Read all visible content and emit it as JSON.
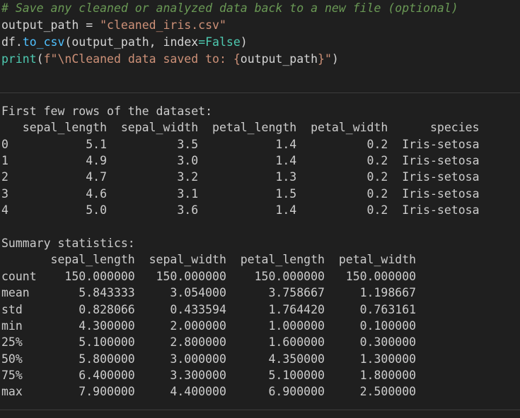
{
  "code": {
    "line1": {
      "comment": "# Save any cleaned or analyzed data back to a new file (optional)"
    },
    "line2": {
      "var": "output_path",
      "op": " = ",
      "str": "\"cleaned_iris.csv\""
    },
    "line3": {
      "obj": "df",
      "dot": ".",
      "method": "to_csv",
      "open": "(",
      "arg1": "output_path",
      "sep": ", ",
      "kwarg": "index",
      "eq": "=",
      "val": "False",
      "close": ")"
    },
    "line4": {
      "func": "print",
      "open": "(",
      "prefix": "f",
      "str_start": "\"\\nCleaned data saved to: ",
      "brace_open": "{",
      "inner": "output_path",
      "brace_close": "}",
      "str_end": "\"",
      "close": ")"
    }
  },
  "output": {
    "heading1": "First few rows of the dataset:",
    "head_table": {
      "header": "   sepal_length  sepal_width  petal_length  petal_width      species",
      "rows": [
        "0           5.1          3.5           1.4          0.2  Iris-setosa",
        "1           4.9          3.0           1.4          0.2  Iris-setosa",
        "2           4.7          3.2           1.3          0.2  Iris-setosa",
        "3           4.6          3.1           1.5          0.2  Iris-setosa",
        "4           5.0          3.6           1.4          0.2  Iris-setosa"
      ]
    },
    "heading2": "Summary statistics:",
    "stats_table": {
      "header": "       sepal_length  sepal_width  petal_length  petal_width",
      "rows": [
        "count    150.000000   150.000000    150.000000   150.000000",
        "mean       5.843333     3.054000      3.758667     1.198667",
        "std        0.828066     0.433594      1.764420     0.763161",
        "min        4.300000     2.000000      1.000000     0.100000",
        "25%        5.100000     2.800000      1.600000     0.300000",
        "50%        5.800000     3.000000      4.350000     1.300000",
        "75%        6.400000     3.300000      5.100000     1.800000",
        "max        7.900000     4.400000      6.900000     2.500000"
      ]
    }
  },
  "colors": {
    "background": "#1f1f1f",
    "comment": "#6a9955",
    "variable": "#9cdcfe",
    "string": "#ce9178",
    "function": "#dcdcaa",
    "keyword": "#569cd6",
    "text": "#cccccc"
  }
}
